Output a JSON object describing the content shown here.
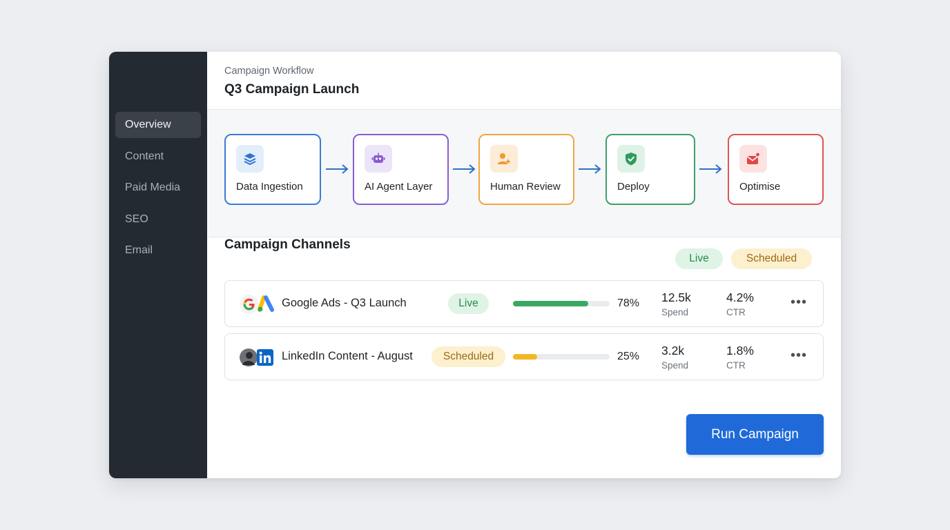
{
  "sidebar": {
    "items": [
      {
        "label": "Overview",
        "active": true
      },
      {
        "label": "Content"
      },
      {
        "label": "Paid Media"
      },
      {
        "label": "SEO"
      },
      {
        "label": "Email"
      }
    ]
  },
  "header": {
    "breadcrumb": "Campaign Workflow",
    "title": "Q3 Campaign Launch"
  },
  "workflow": {
    "steps": [
      {
        "label": "Data Ingestion",
        "icon": "layers-icon",
        "color": "#3a7bd5"
      },
      {
        "label": "AI Agent Layer",
        "icon": "robot-icon",
        "color": "#8a5cd0"
      },
      {
        "label": "Human Review",
        "icon": "user-add-icon",
        "color": "#f0a640"
      },
      {
        "label": "Deploy",
        "icon": "shield-check-icon",
        "color": "#3f9e6a"
      },
      {
        "label": "Optimise",
        "icon": "mail-chart-icon",
        "color": "#e05252"
      }
    ]
  },
  "channels": {
    "heading": "Campaign Channels",
    "legend": {
      "live": "Live",
      "scheduled": "Scheduled"
    },
    "rows": [
      {
        "name": "Google Ads - Q3 Launch",
        "icons": [
          "google-icon",
          "google-ads-icon"
        ],
        "status": "Live",
        "progress_pct": 78,
        "progress_label": "78%",
        "spend": "12.5k",
        "spend_label": "Spend",
        "ctr": "4.2%",
        "ctr_label": "CTR",
        "bar_color": "#3aa862"
      },
      {
        "name": "LinkedIn Content - August",
        "icons": [
          "avatar-icon",
          "linkedin-icon"
        ],
        "status": "Scheduled",
        "progress_pct": 25,
        "progress_label": "25%",
        "spend": "3.2k",
        "spend_label": "Spend",
        "ctr": "1.8%",
        "ctr_label": "CTR",
        "bar_color": "#f2b824"
      }
    ]
  },
  "actions": {
    "run_label": "Run Campaign"
  },
  "colors": {
    "sidebar_bg": "#232a31",
    "primary": "#1f6ad8"
  }
}
